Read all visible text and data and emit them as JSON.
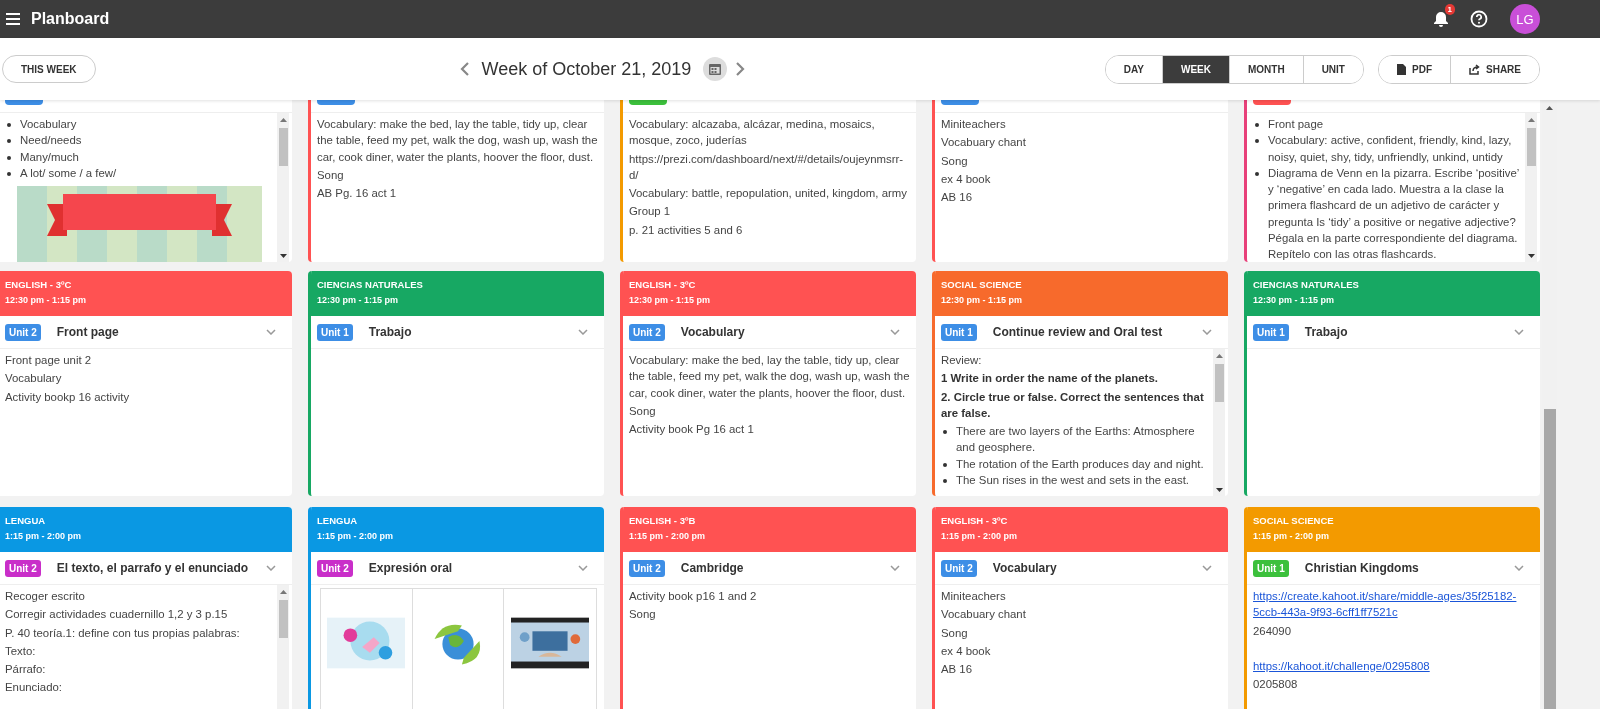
{
  "app": {
    "title": "Planboard",
    "notifications": "1",
    "avatar": "LG"
  },
  "toolbar": {
    "this_week": "THIS WEEK",
    "week_title": "Week of October 21, 2019",
    "views": [
      {
        "label": "DAY",
        "selected": false
      },
      {
        "label": "WEEK",
        "selected": true
      },
      {
        "label": "MONTH",
        "selected": false
      },
      {
        "label": "UNIT",
        "selected": false
      }
    ],
    "actions": [
      {
        "label": "PDF",
        "kind": "pdf"
      },
      {
        "label": "SHARE",
        "kind": "share"
      }
    ]
  },
  "rows": [
    {
      "cards": [
        {
          "unit": {
            "color": "#3d8ee6"
          },
          "scrollable": true,
          "body": [
            {
              "kind": "bullets",
              "items": [
                "Vocabulary",
                "Need/needs",
                "Many/much",
                "A lot/ some / a few/"
              ]
            },
            {
              "kind": "picture"
            }
          ]
        },
        {
          "color": "#ff5252",
          "unit": {
            "color": "#3d8ee6"
          },
          "scrollable": false,
          "body": [
            {
              "kind": "text",
              "text": "Vocabulary: make the bed, lay the table, tidy up, clear the table, feed my pet, walk the dog, wash up, wash the car, cook diner, water the plants, hoover the floor, dust."
            },
            {
              "kind": "text",
              "text": "Song"
            },
            {
              "kind": "text",
              "text": "AB Pg. 16 act 1"
            }
          ]
        },
        {
          "color": "#f39a00",
          "unit": {
            "color": "#3cc03c"
          },
          "scrollable": false,
          "body": [
            {
              "kind": "text",
              "text": "Vocabulary: alcazaba, alcázar, medina, mosaics, mosque, zoco, juderías"
            },
            {
              "kind": "text",
              "text": "https://prezi.com/dashboard/next/#/details/oujeynmsrr-d/"
            },
            {
              "kind": "text",
              "text": "Vocabulary: battle, repopulation, united, kingdom, army"
            },
            {
              "kind": "text",
              "text": "Group 1"
            },
            {
              "kind": "text",
              "text": "p. 21 activities 5 and 6"
            }
          ]
        },
        {
          "color": "#ff5252",
          "unit": {
            "color": "#3d8ee6"
          },
          "scrollable": false,
          "body": [
            {
              "kind": "text",
              "text": "Miniteachers"
            },
            {
              "kind": "text",
              "text": "Vocabuary chant"
            },
            {
              "kind": "text",
              "text": "Song"
            },
            {
              "kind": "text",
              "text": "ex 4 book"
            },
            {
              "kind": "text",
              "text": "AB 16"
            }
          ]
        },
        {
          "color": "#e8407a",
          "unit": {
            "color": "#ff5252"
          },
          "scrollable": true,
          "body": [
            {
              "kind": "bullets",
              "items": [
                "Front page",
                "Vocabulary: active, confident, friendly, kind, lazy, noisy, quiet, shy, tidy, unfriendly, unkind, untidy",
                "Diagrama de Venn en la pizarra. Escribe ‘positive’ y ‘negative’ en cada lado. Muestra a la clase la primera flashcard de un adjetivo de carácter y pregunta Is ‘tidy’ a positive or negative adjective? Pégala en la parte correspondiente del diagrama. Repítelo con las otras flashcards."
              ]
            }
          ]
        }
      ]
    },
    {
      "cards": [
        {
          "subject": "ENGLISH - 3ºC",
          "time": "12:30 pm - 1:15 pm",
          "color": "#ff5252",
          "unit": {
            "label": "Unit 2",
            "color": "#3d8ee6"
          },
          "title": "Front page",
          "scrollable": false,
          "body": [
            {
              "kind": "text",
              "text": "Front page unit 2"
            },
            {
              "kind": "text",
              "text": "Vocabulary"
            },
            {
              "kind": "text",
              "text": "Activity bookp 16 activity"
            }
          ]
        },
        {
          "subject": "CIENCIAS NATURALES",
          "time": "12:30 pm - 1:15 pm",
          "color": "#17a863",
          "unit": {
            "label": "Unit 1",
            "color": "#3d8ee6"
          },
          "title": "Trabajo",
          "scrollable": false
        },
        {
          "subject": "ENGLISH - 3ºC",
          "time": "12:30 pm - 1:15 pm",
          "color": "#ff5252",
          "unit": {
            "label": "Unit 2",
            "color": "#3d8ee6"
          },
          "title": "Vocabulary",
          "scrollable": false,
          "body": [
            {
              "kind": "text",
              "text": "Vocabulary: make the bed, lay the table, tidy up, clear the table, feed my pet, walk the dog, wash up, wash the car, cook diner, water the plants, hoover the floor, dust."
            },
            {
              "kind": "text",
              "text": "Song"
            },
            {
              "kind": "text",
              "text": "Activity book Pg 16 act 1"
            }
          ]
        },
        {
          "subject": "SOCIAL SCIENCE",
          "time": "12:30 pm - 1:15 pm",
          "color": "#f76a2c",
          "unit": {
            "label": "Unit 1",
            "color": "#3d8ee6"
          },
          "title": "Continue review and Oral test",
          "scrollable": true,
          "body": [
            {
              "kind": "text",
              "text": "Review:"
            },
            {
              "kind": "bold",
              "text": "1 Write in order the name of the planets."
            },
            {
              "kind": "bold",
              "text": "2. Circle true or false. Correct the sentences that are false."
            },
            {
              "kind": "bullets",
              "items": [
                "There are two layers of the Earths: Atmosphere and geosphere.",
                "The rotation of the Earth produces day and night.",
                "The Sun rises in the west and sets in the east."
              ]
            }
          ]
        },
        {
          "subject": "CIENCIAS NATURALES",
          "time": "12:30 pm - 1:15 pm",
          "color": "#17a863",
          "unit": {
            "label": "Unit 1",
            "color": "#3d8ee6"
          },
          "title": "Trabajo",
          "scrollable": false
        }
      ]
    },
    {
      "cards": [
        {
          "subject": "LENGUA",
          "time": "1:15 pm - 2:00 pm",
          "color": "#0a98e3",
          "unit": {
            "label": "Unit 2",
            "color": "#c92ec9"
          },
          "title": "El texto, el parrafo y el enunciado",
          "scrollable": true,
          "body": [
            {
              "kind": "text",
              "text": "Recoger escrito"
            },
            {
              "kind": "text",
              "text": "Corregir actividades cuadernillo 1,2 y 3 p.15"
            },
            {
              "kind": "text",
              "text": "P. 40 teoría.1: define con tus propias palabras:"
            },
            {
              "kind": "text",
              "text": "Texto:"
            },
            {
              "kind": "text",
              "text": "Párrafo:"
            },
            {
              "kind": "text",
              "text": "Enunciado:"
            }
          ]
        },
        {
          "subject": "LENGUA",
          "time": "1:15 pm - 2:00 pm",
          "color": "#0a98e3",
          "unit": {
            "label": "Unit 2",
            "color": "#c92ec9"
          },
          "title": "Expresión oral",
          "scrollable": false,
          "body": [
            {
              "kind": "gallery",
              "items": [
                {
                  "kind": "picture"
                },
                {
                  "kind": "picture"
                },
                {
                  "kind": "picture"
                }
              ]
            }
          ]
        },
        {
          "subject": "ENGLISH - 3ºB",
          "time": "1:15 pm - 2:00 pm",
          "color": "#ff5252",
          "unit": {
            "label": "Unit 2",
            "color": "#3d8ee6"
          },
          "title": "Cambridge",
          "scrollable": false,
          "body": [
            {
              "kind": "text",
              "text": "Activity book p16 1 and 2"
            },
            {
              "kind": "text",
              "text": "Song"
            }
          ]
        },
        {
          "subject": "ENGLISH - 3ºC",
          "time": "1:15 pm - 2:00 pm",
          "color": "#ff5252",
          "unit": {
            "label": "Unit 2",
            "color": "#3d8ee6"
          },
          "title": "Vocabulary",
          "scrollable": false,
          "body": [
            {
              "kind": "text",
              "text": "Miniteachers"
            },
            {
              "kind": "text",
              "text": "Vocabuary chant"
            },
            {
              "kind": "text",
              "text": "Song"
            },
            {
              "kind": "text",
              "text": "ex 4 book"
            },
            {
              "kind": "text",
              "text": "AB 16"
            }
          ]
        },
        {
          "subject": "SOCIAL SCIENCE",
          "time": "1:15 pm - 2:00 pm",
          "color": "#f39a00",
          "unit": {
            "label": "Unit 1",
            "color": "#3cc03c"
          },
          "title": "Christian Kingdoms",
          "scrollable": false,
          "body": [
            {
              "kind": "link",
              "text": "https://create.kahoot.it/share/middle-ages/35f25182-5ccb-443a-9f93-6cff1ff7521c"
            },
            {
              "kind": "text",
              "text": "264090"
            },
            {
              "kind": "link",
              "gap_before": true,
              "text": "https://kahoot.it/challenge/0295808"
            },
            {
              "kind": "text",
              "text": "0205808"
            }
          ]
        }
      ]
    }
  ]
}
